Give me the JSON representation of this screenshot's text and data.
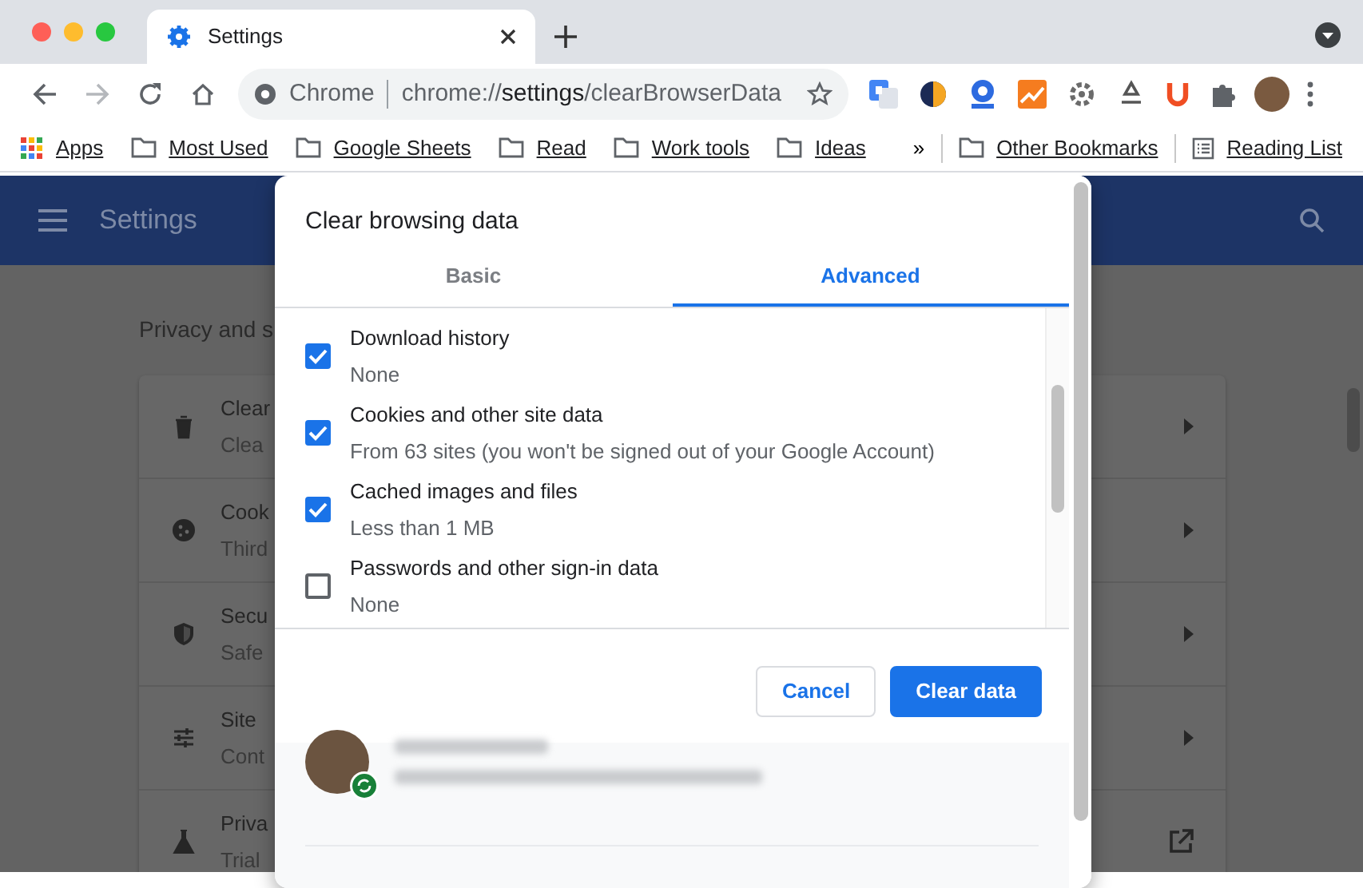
{
  "browser": {
    "tab": {
      "title": "Settings"
    },
    "omnibox": {
      "chip": "Chrome",
      "url_scheme": "chrome://",
      "url_host": "settings",
      "url_path": "/clearBrowserData"
    },
    "bookmarks": [
      {
        "kind": "apps",
        "label": "Apps"
      },
      {
        "kind": "folder",
        "label": "Most Used"
      },
      {
        "kind": "folder",
        "label": "Google Sheets"
      },
      {
        "kind": "folder",
        "label": "Read"
      },
      {
        "kind": "folder",
        "label": "Work tools"
      },
      {
        "kind": "folder",
        "label": "Ideas"
      }
    ],
    "overflow": "»",
    "other_bookmarks": "Other Bookmarks",
    "reading_list": "Reading List"
  },
  "settings_page": {
    "title": "Settings",
    "section_heading": "Privacy and s",
    "rows": [
      {
        "title": "Clear",
        "subtitle": "Clea",
        "kind": "submenu"
      },
      {
        "title": "Cook",
        "subtitle": "Third",
        "kind": "submenu"
      },
      {
        "title": "Secu",
        "subtitle": "Safe",
        "kind": "submenu"
      },
      {
        "title": "Site",
        "subtitle": "Cont",
        "kind": "submenu"
      },
      {
        "title": "Priva",
        "subtitle": "Trial",
        "kind": "external"
      }
    ]
  },
  "dialog": {
    "title": "Clear browsing data",
    "tabs": [
      {
        "label": "Basic",
        "selected": false
      },
      {
        "label": "Advanced",
        "selected": true
      }
    ],
    "items": [
      {
        "label": "Download history",
        "detail": "None",
        "checked": true
      },
      {
        "label": "Cookies and other site data",
        "detail": "From 63 sites (you won't be signed out of your Google Account)",
        "checked": true
      },
      {
        "label": "Cached images and files",
        "detail": "Less than 1 MB",
        "checked": true
      },
      {
        "label": "Passwords and other sign-in data",
        "detail": "None",
        "checked": false
      }
    ],
    "buttons": [
      {
        "label": "Cancel",
        "kind": "secondary"
      },
      {
        "label": "Clear data",
        "kind": "primary"
      }
    ]
  }
}
